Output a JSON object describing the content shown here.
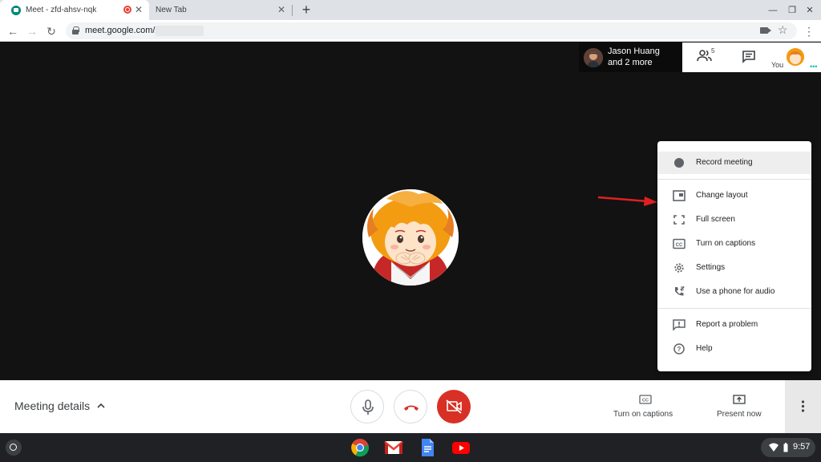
{
  "browser": {
    "tabs": [
      {
        "title": "Meet - zfd-ahsv-nqk",
        "active": true,
        "recording": true
      },
      {
        "title": "New Tab",
        "active": false
      }
    ],
    "address": {
      "url": "meet.google.com/z"
    },
    "colors": {
      "tabstrip": "#dee1e6",
      "meet_icon": "#00897b",
      "record_indicator": "#ea4335"
    }
  },
  "participants": {
    "main_participant": "Jason Huang",
    "others": "and 2 more",
    "people_count": "5",
    "you_label": "You"
  },
  "menu": {
    "items": [
      {
        "label": "Record meeting",
        "icon": "record-dot-icon",
        "highlighted": true
      },
      {
        "label": "Change layout",
        "icon": "layout-icon"
      },
      {
        "label": "Full screen",
        "icon": "fullscreen-icon"
      },
      {
        "label": "Turn on captions",
        "icon": "captions-icon"
      },
      {
        "label": "Settings",
        "icon": "gear-icon"
      },
      {
        "label": "Use a phone for audio",
        "icon": "phone-audio-icon"
      },
      {
        "label": "Report a problem",
        "icon": "report-icon"
      },
      {
        "label": "Help",
        "icon": "help-icon"
      }
    ]
  },
  "callbar": {
    "meeting_details": "Meeting details",
    "captions_label": "Turn on captions",
    "present_label": "Present now",
    "colors": {
      "camera_off": "#d93025",
      "hangup_icon": "#d93025"
    }
  },
  "shelf": {
    "time": "9:57",
    "apps": [
      "chrome-icon",
      "gmail-icon",
      "docs-icon",
      "youtube-icon"
    ]
  },
  "annotation": {
    "arrow_color": "#e02020"
  }
}
